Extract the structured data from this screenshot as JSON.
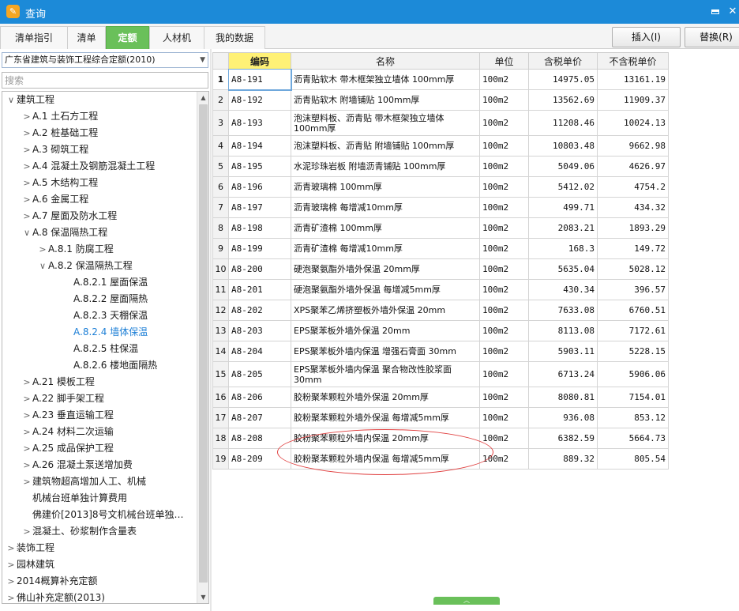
{
  "window": {
    "title": "查询"
  },
  "tabs": [
    {
      "label": "清单指引",
      "active": false
    },
    {
      "label": "清单",
      "active": false
    },
    {
      "label": "定额",
      "active": true
    },
    {
      "label": "人材机",
      "active": false
    },
    {
      "label": "我的数据",
      "active": false
    }
  ],
  "toolbar": {
    "insert_label": "插入(I)",
    "replace_label": "替换(R)"
  },
  "sidebar": {
    "quota_book": "广东省建筑与装饰工程综合定额(2010)",
    "search_placeholder": "搜索",
    "tree": [
      {
        "label": "建筑工程",
        "arrow": "∨",
        "level": 0
      },
      {
        "label": "A.1 土石方工程",
        "arrow": ">",
        "level": 1
      },
      {
        "label": "A.2 桩基础工程",
        "arrow": ">",
        "level": 1
      },
      {
        "label": "A.3 砌筑工程",
        "arrow": ">",
        "level": 1
      },
      {
        "label": "A.4 混凝土及钢筋混凝土工程",
        "arrow": ">",
        "level": 1
      },
      {
        "label": "A.5 木结构工程",
        "arrow": ">",
        "level": 1
      },
      {
        "label": "A.6 金属工程",
        "arrow": ">",
        "level": 1
      },
      {
        "label": "A.7 屋面及防水工程",
        "arrow": ">",
        "level": 1
      },
      {
        "label": "A.8 保温隔热工程",
        "arrow": "∨",
        "level": 1
      },
      {
        "label": "A.8.1 防腐工程",
        "arrow": ">",
        "level": 2
      },
      {
        "label": "A.8.2 保温隔热工程",
        "arrow": "∨",
        "level": 2
      },
      {
        "label": "A.8.2.1 屋面保温",
        "arrow": "",
        "level": 3
      },
      {
        "label": "A.8.2.2 屋面隔热",
        "arrow": "",
        "level": 3
      },
      {
        "label": "A.8.2.3 天棚保温",
        "arrow": "",
        "level": 3
      },
      {
        "label": "A.8.2.4 墙体保温",
        "arrow": "",
        "level": 3,
        "selected": true
      },
      {
        "label": "A.8.2.5 柱保温",
        "arrow": "",
        "level": 3
      },
      {
        "label": "A.8.2.6 楼地面隔热",
        "arrow": "",
        "level": 3
      },
      {
        "label": "A.21 模板工程",
        "arrow": ">",
        "level": 1
      },
      {
        "label": "A.22 脚手架工程",
        "arrow": ">",
        "level": 1
      },
      {
        "label": "A.23 垂直运输工程",
        "arrow": ">",
        "level": 1
      },
      {
        "label": "A.24 材料二次运输",
        "arrow": ">",
        "level": 1
      },
      {
        "label": "A.25 成品保护工程",
        "arrow": ">",
        "level": 1
      },
      {
        "label": "A.26 混凝土泵送增加费",
        "arrow": ">",
        "level": 1
      },
      {
        "label": "建筑物超高增加人工、机械",
        "arrow": ">",
        "level": 1
      },
      {
        "label": "机械台班单独计算费用",
        "arrow": "",
        "level": 1
      },
      {
        "label": "佛建价[2013]8号文机械台班单独…",
        "arrow": "",
        "level": 1
      },
      {
        "label": "混凝土、砂浆制作含量表",
        "arrow": ">",
        "level": 1
      },
      {
        "label": "装饰工程",
        "arrow": ">",
        "level": 0
      },
      {
        "label": "园林建筑",
        "arrow": ">",
        "level": 0
      },
      {
        "label": "2014概算补充定额",
        "arrow": ">",
        "level": 0
      },
      {
        "label": "佛山补充定额(2013)",
        "arrow": ">",
        "level": 0
      }
    ]
  },
  "table": {
    "headers": [
      "编码",
      "名称",
      "单位",
      "含税单价",
      "不含税单价"
    ],
    "rows": [
      {
        "no": "1",
        "code": "A8-191",
        "name": "沥青贴软木 带木框架独立墙体 100mm厚",
        "unit": "100m2",
        "price_tax": "14975.05",
        "price_notax": "13161.19",
        "tall": false
      },
      {
        "no": "2",
        "code": "A8-192",
        "name": "沥青贴软木 附墙铺贴 100mm厚",
        "unit": "100m2",
        "price_tax": "13562.69",
        "price_notax": "11909.37",
        "tall": false
      },
      {
        "no": "3",
        "code": "A8-193",
        "name": "泡沫塑料板、沥青贴 带木框架独立墙体 100mm厚",
        "unit": "100m2",
        "price_tax": "11208.46",
        "price_notax": "10024.13",
        "tall": true
      },
      {
        "no": "4",
        "code": "A8-194",
        "name": "泡沫塑料板、沥青贴 附墙铺贴 100mm厚",
        "unit": "100m2",
        "price_tax": "10803.48",
        "price_notax": "9662.98",
        "tall": false
      },
      {
        "no": "5",
        "code": "A8-195",
        "name": "水泥珍珠岩板 附墙沥青铺贴 100mm厚",
        "unit": "100m2",
        "price_tax": "5049.06",
        "price_notax": "4626.97",
        "tall": false
      },
      {
        "no": "6",
        "code": "A8-196",
        "name": "沥青玻璃棉 100mm厚",
        "unit": "100m2",
        "price_tax": "5412.02",
        "price_notax": "4754.2",
        "tall": false
      },
      {
        "no": "7",
        "code": "A8-197",
        "name": "沥青玻璃棉 每增减10mm厚",
        "unit": "100m2",
        "price_tax": "499.71",
        "price_notax": "434.32",
        "tall": false
      },
      {
        "no": "8",
        "code": "A8-198",
        "name": "沥青矿渣棉 100mm厚",
        "unit": "100m2",
        "price_tax": "2083.21",
        "price_notax": "1893.29",
        "tall": false
      },
      {
        "no": "9",
        "code": "A8-199",
        "name": "沥青矿渣棉 每增减10mm厚",
        "unit": "100m2",
        "price_tax": "168.3",
        "price_notax": "149.72",
        "tall": false
      },
      {
        "no": "10",
        "code": "A8-200",
        "name": "硬泡聚氨酯外墙外保温 20mm厚",
        "unit": "100m2",
        "price_tax": "5635.04",
        "price_notax": "5028.12",
        "tall": false
      },
      {
        "no": "11",
        "code": "A8-201",
        "name": "硬泡聚氨酯外墙外保温 每增减5mm厚",
        "unit": "100m2",
        "price_tax": "430.34",
        "price_notax": "396.57",
        "tall": false
      },
      {
        "no": "12",
        "code": "A8-202",
        "name": "XPS聚苯乙烯挤塑板外墙外保温 20mm",
        "unit": "100m2",
        "price_tax": "7633.08",
        "price_notax": "6760.51",
        "tall": false
      },
      {
        "no": "13",
        "code": "A8-203",
        "name": "EPS聚苯板外墙外保温 20mm",
        "unit": "100m2",
        "price_tax": "8113.08",
        "price_notax": "7172.61",
        "tall": false
      },
      {
        "no": "14",
        "code": "A8-204",
        "name": "EPS聚苯板外墙内保温 增强石膏面 30mm",
        "unit": "100m2",
        "price_tax": "5903.11",
        "price_notax": "5228.15",
        "tall": false
      },
      {
        "no": "15",
        "code": "A8-205",
        "name": "EPS聚苯板外墙内保温 聚合物改性胶浆面 30mm",
        "unit": "100m2",
        "price_tax": "6713.24",
        "price_notax": "5906.06",
        "tall": true
      },
      {
        "no": "16",
        "code": "A8-206",
        "name": "胶粉聚苯颗粒外墙外保温 20mm厚",
        "unit": "100m2",
        "price_tax": "8080.81",
        "price_notax": "7154.01",
        "tall": false
      },
      {
        "no": "17",
        "code": "A8-207",
        "name": "胶粉聚苯颗粒外墙外保温 每增减5mm厚",
        "unit": "100m2",
        "price_tax": "936.08",
        "price_notax": "853.12",
        "tall": false
      },
      {
        "no": "18",
        "code": "A8-208",
        "name": "胶粉聚苯颗粒外墙内保温 20mm厚",
        "unit": "100m2",
        "price_tax": "6382.59",
        "price_notax": "5664.73",
        "tall": false
      },
      {
        "no": "19",
        "code": "A8-209",
        "name": "胶粉聚苯颗粒外墙内保温 每增减5mm厚",
        "unit": "100m2",
        "price_tax": "889.32",
        "price_notax": "805.54",
        "tall": false
      }
    ]
  }
}
